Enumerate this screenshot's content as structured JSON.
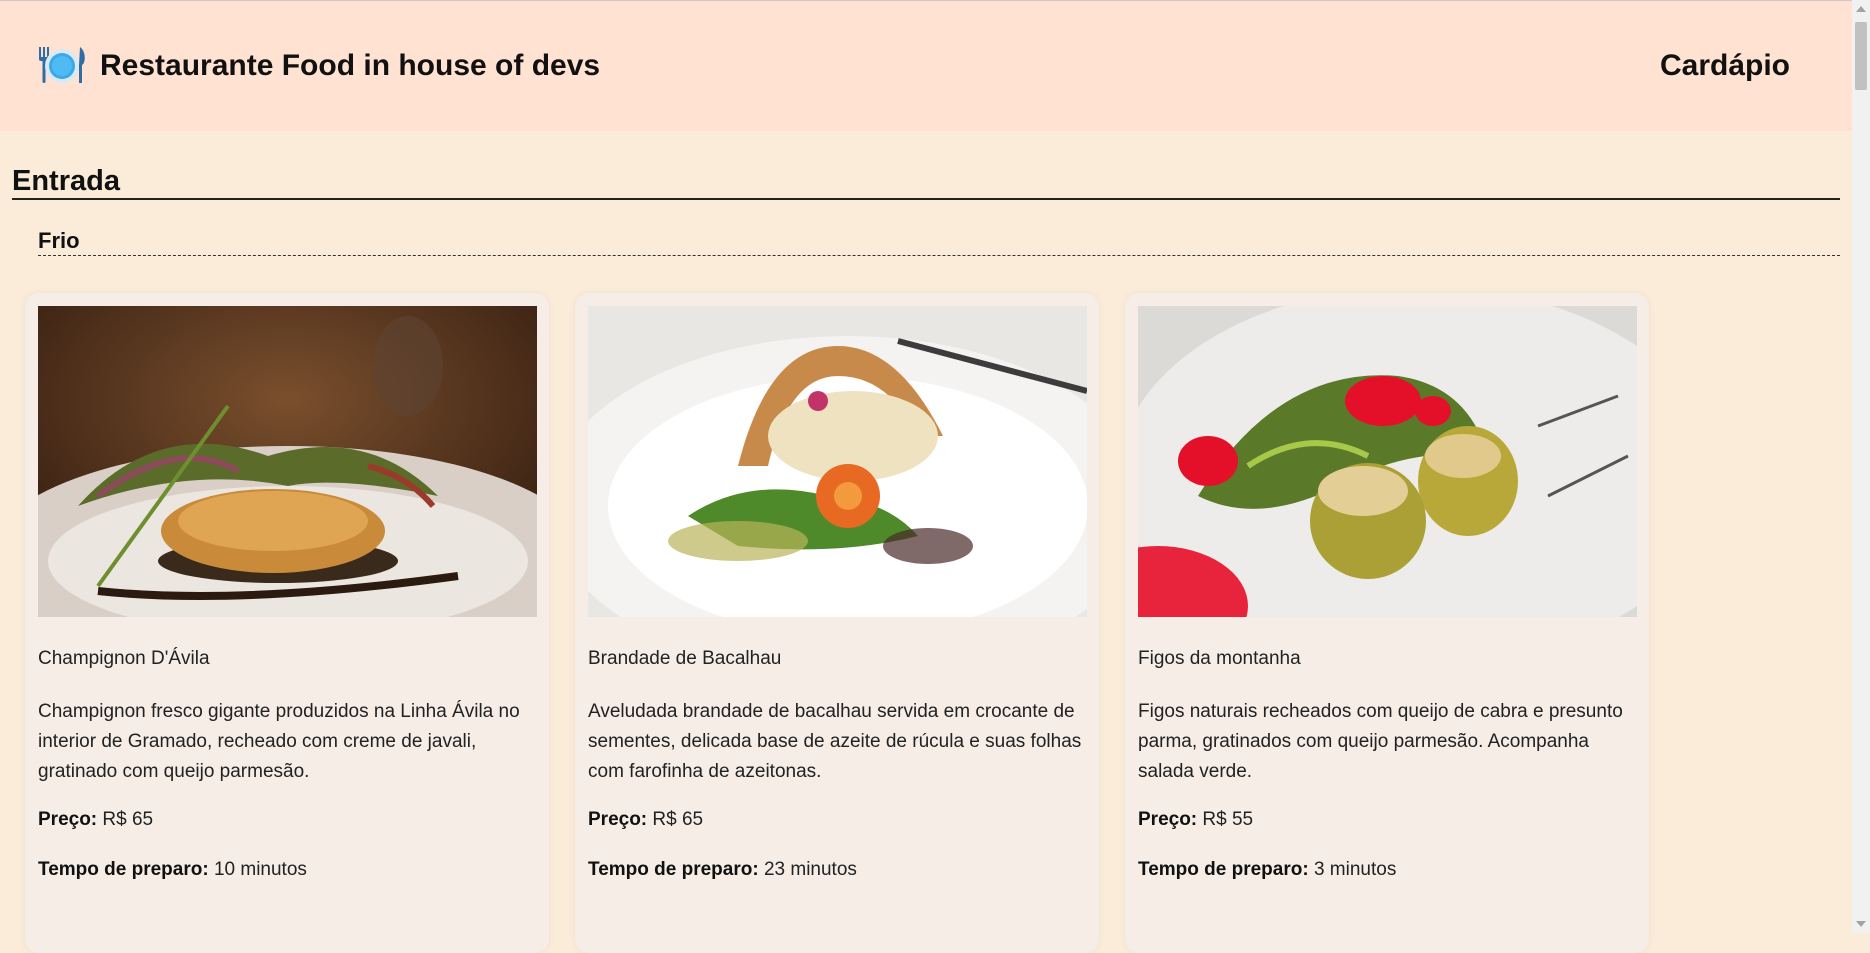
{
  "header": {
    "logo_icon": "plate-with-cutlery-icon",
    "title": "Restaurante Food in house of devs",
    "nav_label": "Cardápio"
  },
  "section": {
    "title": "Entrada",
    "subsection": "Frio"
  },
  "labels": {
    "price": "Preço:",
    "prep_time": "Tempo de preparo:"
  },
  "cards": [
    {
      "name": "Champignon D'Ávila",
      "description": "Champignon fresco gigante produzidos na Linha Ávila no interior de Gramado, recheado com creme de javali, gratinado com queijo parmesão.",
      "price": "R$ 65",
      "prep_time": "10 minutos",
      "image": "stuffed-mushroom-photo"
    },
    {
      "name": "Brandade de Bacalhau",
      "description": "Aveludada brandade de bacalhau servida em crocante de sementes, delicada base de azeite de rúcula e suas folhas com farofinha de azeitonas.",
      "price": "R$ 65",
      "prep_time": "23 minutos",
      "image": "cod-brandade-photo"
    },
    {
      "name": "Figos da montanha",
      "description": "Figos naturais recheados com queijo de cabra e presunto parma, gratinados com queijo parmesão. Acompanha salada verde.",
      "price": "R$ 55",
      "prep_time": "3 minutos",
      "image": "stuffed-figs-photo"
    }
  ],
  "colors": {
    "page_bg": "#fbecd9",
    "header_bg": "#ffe2d1",
    "card_bg": "#f5ede6"
  }
}
